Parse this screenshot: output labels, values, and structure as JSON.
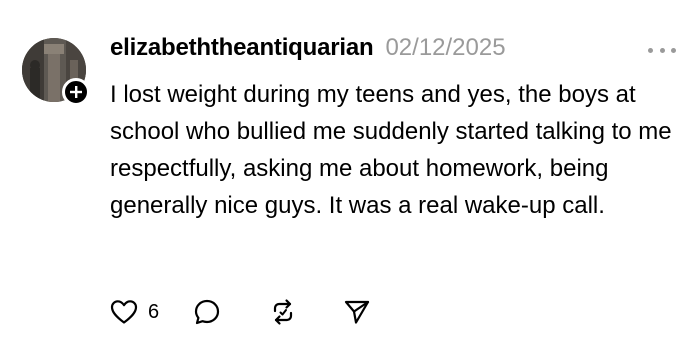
{
  "post": {
    "username": "elizabeththeantiquarian",
    "timestamp": "02/12/2025",
    "text": "I lost weight during my teens and yes, the boys at school who bullied me suddenly started talking to me respectfully, asking me about homework, being generally nice guys. It was a real wake-up call.",
    "like_count": "6"
  },
  "icons": {
    "follow": "plus-icon",
    "more": "more-options-icon",
    "like": "heart-icon",
    "reply": "comment-bubble-icon",
    "repost": "repost-icon",
    "share": "send-icon"
  },
  "colors": {
    "text": "#000000",
    "muted": "#9a9a9a",
    "badge": "#000000"
  }
}
